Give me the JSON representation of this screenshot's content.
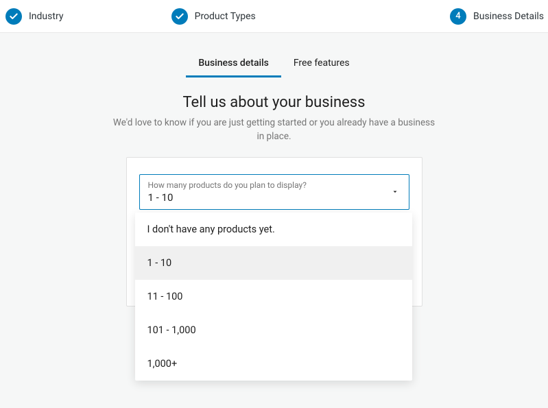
{
  "stepper": {
    "steps": [
      {
        "label": "Industry",
        "completed": true
      },
      {
        "label": "Product Types",
        "completed": true
      },
      {
        "label": "Business Details",
        "number": "4",
        "active": true
      }
    ]
  },
  "tabs": {
    "items": [
      {
        "label": "Business details",
        "active": true
      },
      {
        "label": "Free features",
        "active": false
      }
    ]
  },
  "heading": "Tell us about your business",
  "subheading": "We'd love to know if you are just getting started or you already have a business in place.",
  "product_count_field": {
    "label": "How many products do you plan to display?",
    "value": "1 - 10",
    "options": [
      "I don't have any products yet.",
      "1 - 10",
      "11 - 100",
      "101 - 1,000",
      "1,000+"
    ],
    "selected_index": 1
  }
}
